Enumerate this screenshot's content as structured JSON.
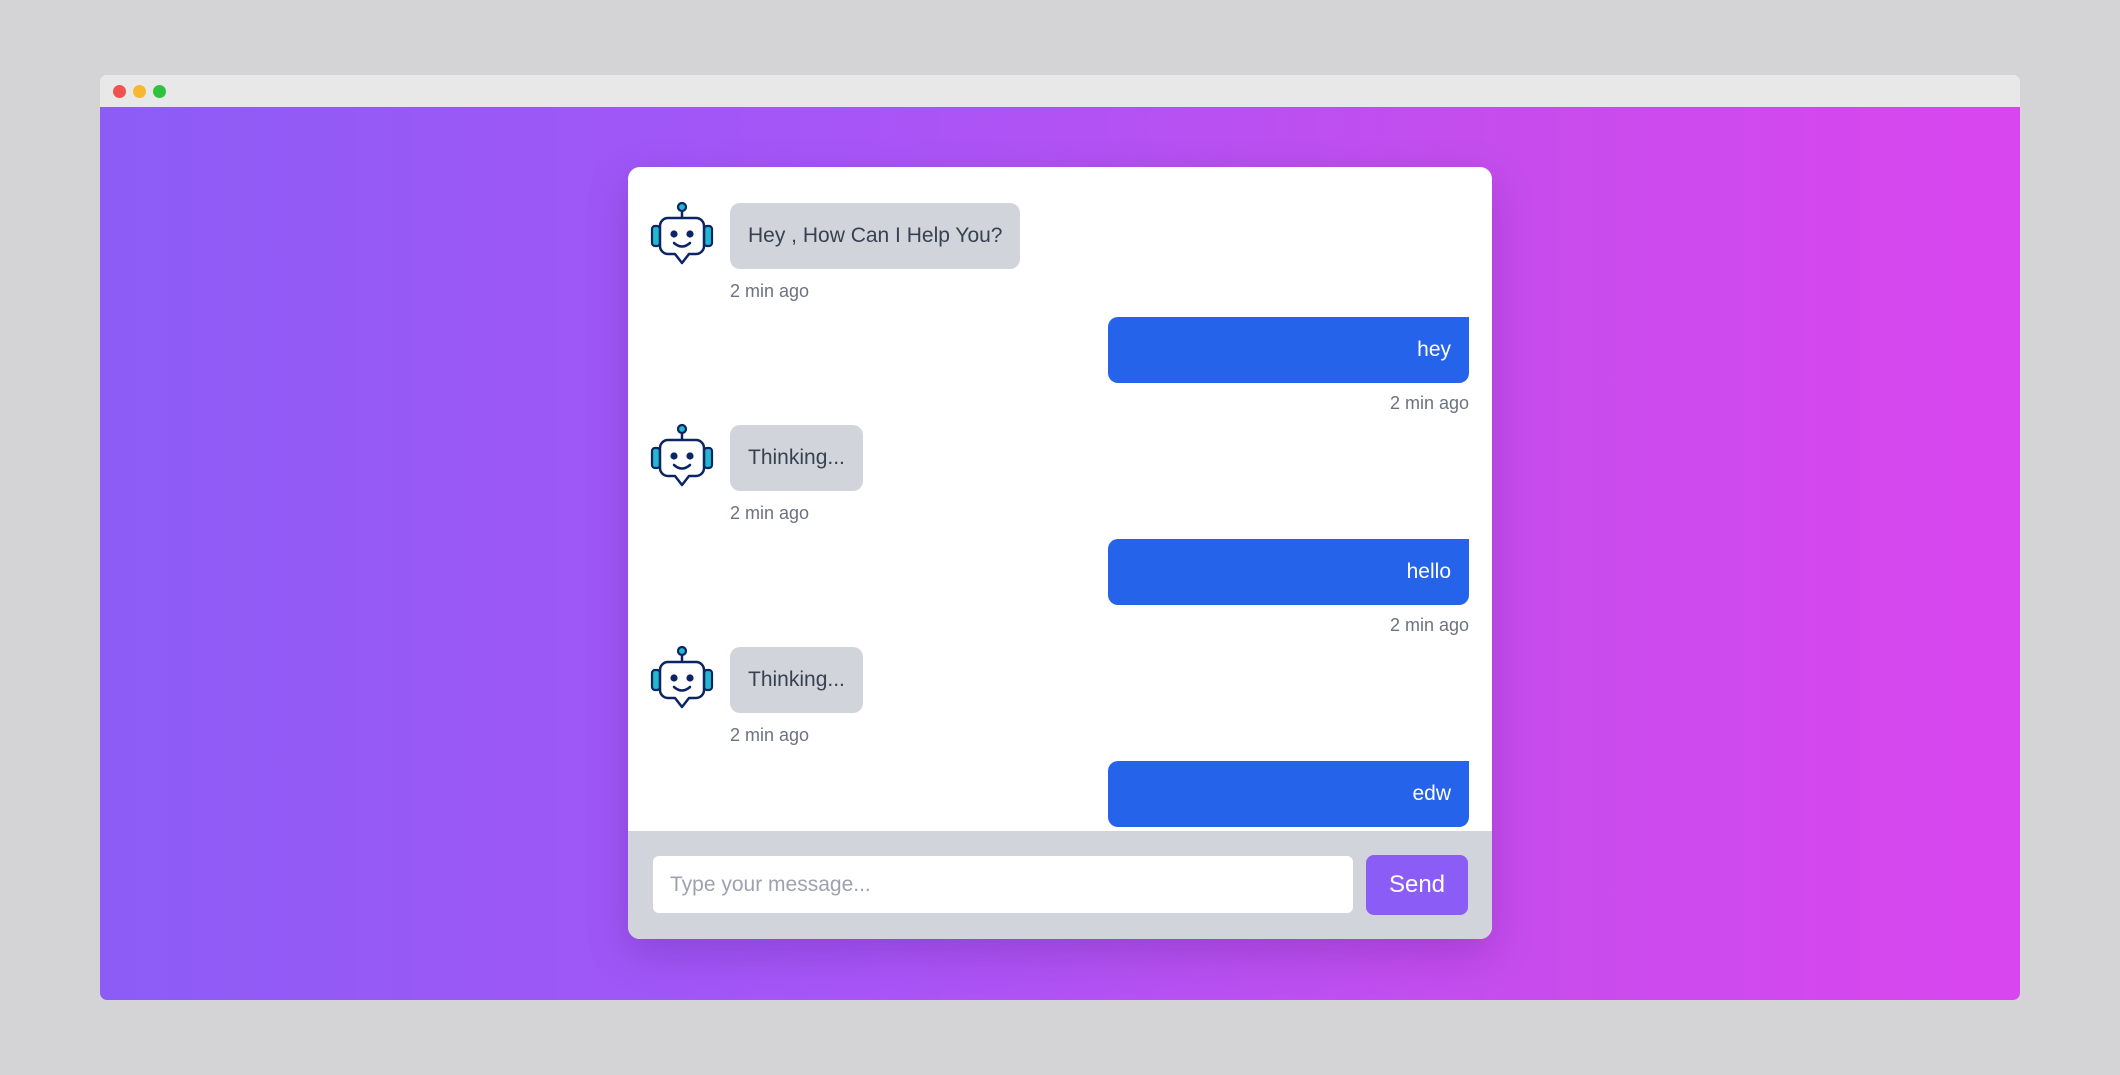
{
  "window": {
    "controls": [
      "close",
      "minimize",
      "maximize"
    ]
  },
  "colors": {
    "background_gradient": [
      "#8c5cf6",
      "#d946ef"
    ],
    "bot_bubble": "#d1d5db",
    "user_bubble": "#2563eb",
    "send_button": "#8b5cf6"
  },
  "chat": {
    "bot_avatar_icon": "robot-chat-icon",
    "messages": [
      {
        "sender": "bot",
        "text": "Hey , How Can I Help You?",
        "time": "2 min ago"
      },
      {
        "sender": "user",
        "text": "hey",
        "time": "2 min ago"
      },
      {
        "sender": "bot",
        "text": "Thinking...",
        "time": "2 min ago"
      },
      {
        "sender": "user",
        "text": "hello",
        "time": "2 min ago"
      },
      {
        "sender": "bot",
        "text": "Thinking...",
        "time": "2 min ago"
      },
      {
        "sender": "user",
        "text": "edw",
        "time": ""
      }
    ]
  },
  "composer": {
    "placeholder": "Type your message...",
    "value": "",
    "send_label": "Send"
  }
}
